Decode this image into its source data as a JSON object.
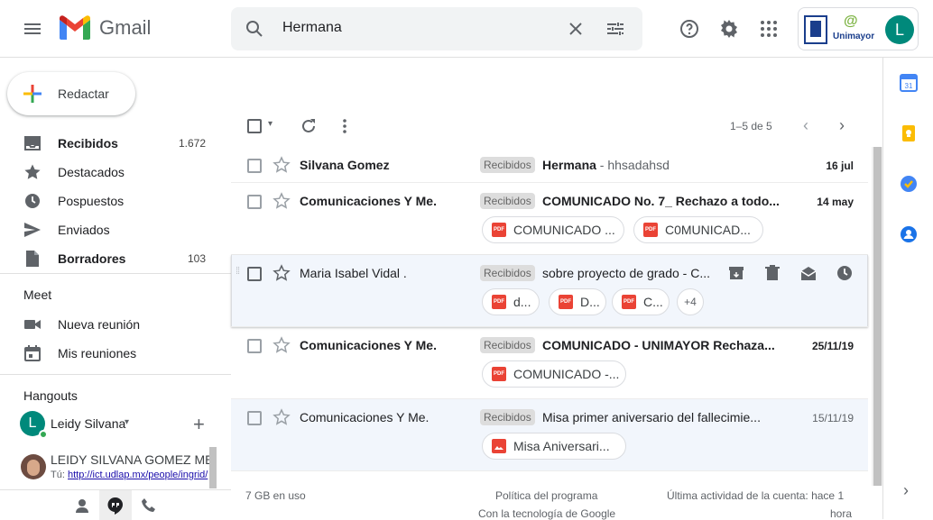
{
  "app": {
    "name": "Gmail"
  },
  "search": {
    "value": "Hermana"
  },
  "account": {
    "avatar_letter": "L",
    "org_name": "Unimayor",
    "org_at": "@"
  },
  "compose": {
    "label": "Redactar"
  },
  "nav": {
    "items": [
      {
        "label": "Recibidos",
        "count": "1.672",
        "icon": "inbox-icon"
      },
      {
        "label": "Destacados",
        "count": "",
        "icon": "star-icon"
      },
      {
        "label": "Pospuestos",
        "count": "",
        "icon": "clock-icon"
      },
      {
        "label": "Enviados",
        "count": "",
        "icon": "send-icon"
      },
      {
        "label": "Borradores",
        "count": "103",
        "icon": "draft-icon"
      }
    ]
  },
  "meet": {
    "title": "Meet",
    "new_meeting": "Nueva reunión",
    "my_meetings": "Mis reuniones"
  },
  "hangouts": {
    "title": "Hangouts",
    "user": "Leidy Silvana",
    "user_letter": "L",
    "contact_name": "LEIDY SILVANA GOMEZ MES",
    "contact_prefix": "Tú:",
    "contact_link": "http://ict.udlap.mx/people/ingrid/"
  },
  "toolbar": {
    "pagination": "1–5 de 5"
  },
  "emails": [
    {
      "sender": "Silvana Gomez",
      "label": "Recibidos",
      "subject": "Hermana",
      "snippet": " - hhsadahsd",
      "date": "16 jul",
      "unread": true
    },
    {
      "sender": "Comunicaciones Y Me.",
      "label": "Recibidos",
      "subject": "COMUNICADO No. 7_ Rechazo a todo...",
      "snippet": "",
      "date": "14 may",
      "unread": true,
      "attachments": [
        "COMUNICADO ...",
        "C0MUNICAD..."
      ]
    },
    {
      "sender": "Maria Isabel Vidal .",
      "label": "Recibidos",
      "subject": "sobre proyecto de grado - C...",
      "snippet": "",
      "date": "",
      "unread": false,
      "attachments": [
        "d...",
        "D...",
        "C..."
      ],
      "more": "+4"
    },
    {
      "sender": "Comunicaciones Y Me.",
      "label": "Recibidos",
      "subject": "COMUNICADO - UNIMAYOR Rechaza...",
      "snippet": "",
      "date": "25/11/19",
      "unread": true,
      "attachments": [
        "COMUNICADO -..."
      ]
    },
    {
      "sender": "Comunicaciones Y Me.",
      "label": "Recibidos",
      "subject": "Misa primer aniversario del fallecimie...",
      "snippet": "",
      "date": "15/11/19",
      "unread": false,
      "attachments": [
        "Misa Aniversari..."
      ]
    }
  ],
  "footer": {
    "storage": "7 GB en uso",
    "policy": "Política del programa",
    "powered": "Con la tecnología de Google",
    "activity_line1": "Última actividad de la cuenta: hace 1",
    "activity_line2": "hora"
  },
  "colors": {
    "accent": "#1a73e8",
    "gmail_red": "#ea4335",
    "avatar": "#00897b"
  }
}
